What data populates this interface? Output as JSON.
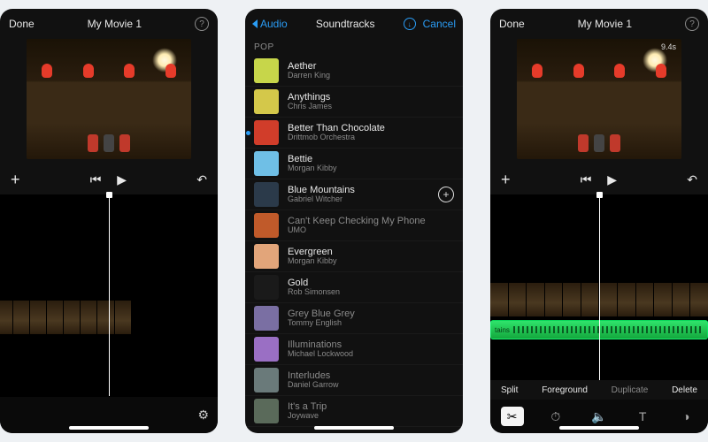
{
  "editor1": {
    "done": "Done",
    "title": "My Movie 1",
    "add_label": "+",
    "prev_glyph": "⏮",
    "play_glyph": "▶",
    "undo_glyph": "↶",
    "gear": "⚙",
    "help": "?"
  },
  "editor2": {
    "done": "Done",
    "title": "My Movie 1",
    "duration": "9.4s",
    "add_label": "+",
    "prev_glyph": "⏮",
    "play_glyph": "▶",
    "undo_glyph": "↶",
    "help": "?",
    "audio_label": "tains",
    "ctx": {
      "split": "Split",
      "foreground": "Foreground",
      "duplicate": "Duplicate",
      "delete": "Delete"
    },
    "tools": {
      "cut": "✂",
      "speed": "⏱",
      "volume": "🔈",
      "text": "T",
      "filter": "◑"
    }
  },
  "soundtracks": {
    "back": "Audio",
    "title": "Soundtracks",
    "cancel": "Cancel",
    "section": "POP",
    "playing_index": 2,
    "add_visible_index": 4,
    "tracks": [
      {
        "title": "Aether",
        "artist": "Darren King",
        "art": "#c7d64a",
        "dim": false
      },
      {
        "title": "Anythings",
        "artist": "Chris James",
        "art": "#d4c84a",
        "dim": false
      },
      {
        "title": "Better Than Chocolate",
        "artist": "Drittmob Orchestra",
        "art": "#d13d2a",
        "dim": false
      },
      {
        "title": "Bettie",
        "artist": "Morgan Kibby",
        "art": "#6fbfe6",
        "dim": false
      },
      {
        "title": "Blue Mountains",
        "artist": "Gabriel Witcher",
        "art": "#2b3a4a",
        "dim": false
      },
      {
        "title": "Can't Keep Checking My Phone",
        "artist": "UMO",
        "art": "#c05a2a",
        "dim": true
      },
      {
        "title": "Evergreen",
        "artist": "Morgan Kibby",
        "art": "#e2a57a",
        "dim": false
      },
      {
        "title": "Gold",
        "artist": "Rob Simonsen",
        "art": "#1a1a1a",
        "dim": false
      },
      {
        "title": "Grey Blue Grey",
        "artist": "Tommy English",
        "art": "#7a6fa3",
        "dim": true
      },
      {
        "title": "Illuminations",
        "artist": "Michael Lockwood",
        "art": "#9a6fc4",
        "dim": true
      },
      {
        "title": "Interludes",
        "artist": "Daniel Garrow",
        "art": "#6a7a7a",
        "dim": true
      },
      {
        "title": "It's a Trip",
        "artist": "Joywave",
        "art": "#5a6a5a",
        "dim": true
      }
    ]
  }
}
